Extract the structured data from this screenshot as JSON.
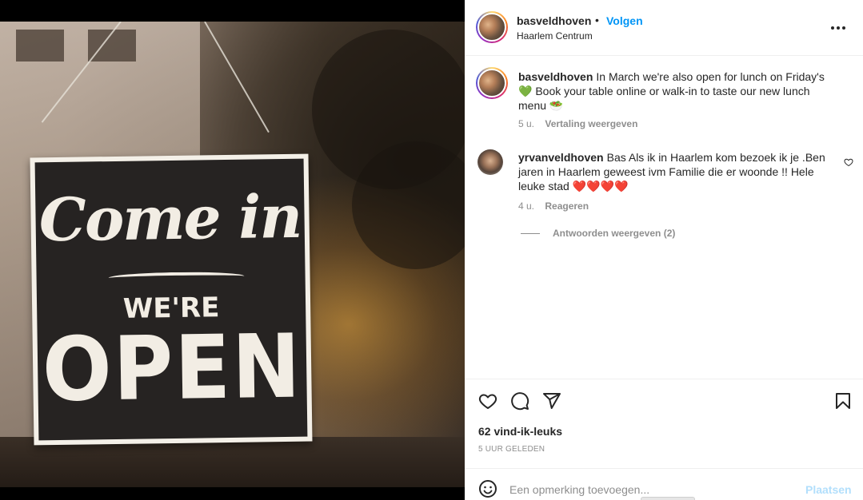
{
  "post": {
    "author": "basveldhoven",
    "follow_label": "Volgen",
    "separator": "•",
    "location": "Haarlem Centrum"
  },
  "image": {
    "sign_line1": "Come in",
    "sign_line2": "WE'RE",
    "sign_line3": "OPEN"
  },
  "caption": {
    "username": "basveldhoven",
    "text_part1": "In March we're also open for lunch on Friday's",
    "green_heart": "💚",
    "text_part2": "Book your table online or walk-in to taste our new lunch menu",
    "food_emoji": "🥗",
    "time": "5 u.",
    "translate_label": "Vertaling weergeven"
  },
  "comments": [
    {
      "username": "yrvanveldhoven",
      "text": "Bas Als ik in Haarlem kom bezoek ik je .Ben jaren in Haarlem geweest ivm Familie die er woonde !! Hele leuke stad",
      "hearts": "❤️❤️❤️❤️",
      "time": "4 u.",
      "reply_label": "Reageren",
      "view_replies_label": "Antwoorden weergeven (2)"
    }
  ],
  "actions": {
    "likes_label": "62 vind-ik-leuks",
    "posted_label": "5 uur geleden"
  },
  "add_comment": {
    "placeholder": "Een opmerking toevoegen...",
    "post_label": "Plaatsen"
  },
  "colors": {
    "link_blue": "#0095f6",
    "post_disabled_blue": "#b2dffc",
    "muted_text": "#8e8e8e",
    "text": "#262626"
  },
  "icons": [
    "more-icon",
    "heart-icon",
    "comment-icon",
    "share-icon",
    "bookmark-icon",
    "emoji-icon",
    "small-heart-icon"
  ]
}
